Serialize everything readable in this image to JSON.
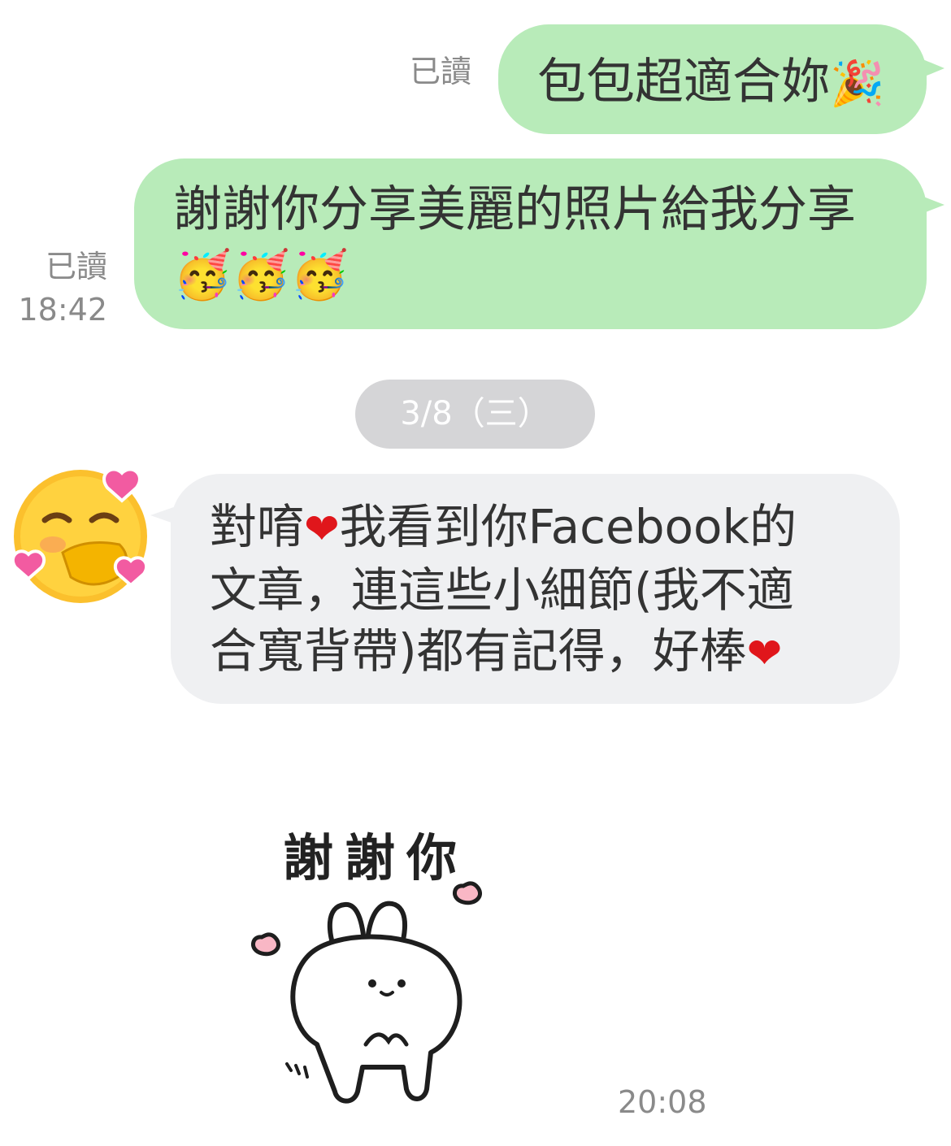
{
  "messages": [
    {
      "direction": "out",
      "status": "已讀",
      "time": "",
      "text": "包包超適合妳",
      "emoji": "🎉"
    },
    {
      "direction": "out",
      "status": "已讀",
      "time": "18:42",
      "line1": "謝謝你分享美麗的照片給我分享",
      "emoji_line": "🥳🥳🥳"
    },
    {
      "direction": "in",
      "line1a": "對唷",
      "line1b": "我看到你Facebook的",
      "line2": "文章，連這些小細節(我不適",
      "line3": "合寬背帶)都有記得，好棒"
    },
    {
      "direction": "in",
      "type": "sticker",
      "sticker_text": "謝謝你",
      "time": "20:08"
    }
  ],
  "date_separator": "3/8（三）",
  "avatar_emoji": "🥰",
  "colors": {
    "outgoing_bubble": "#b8ebb9",
    "incoming_bubble": "#eff0f2",
    "meta_text": "#8a8a8a",
    "date_pill": "#d5d5d7"
  }
}
